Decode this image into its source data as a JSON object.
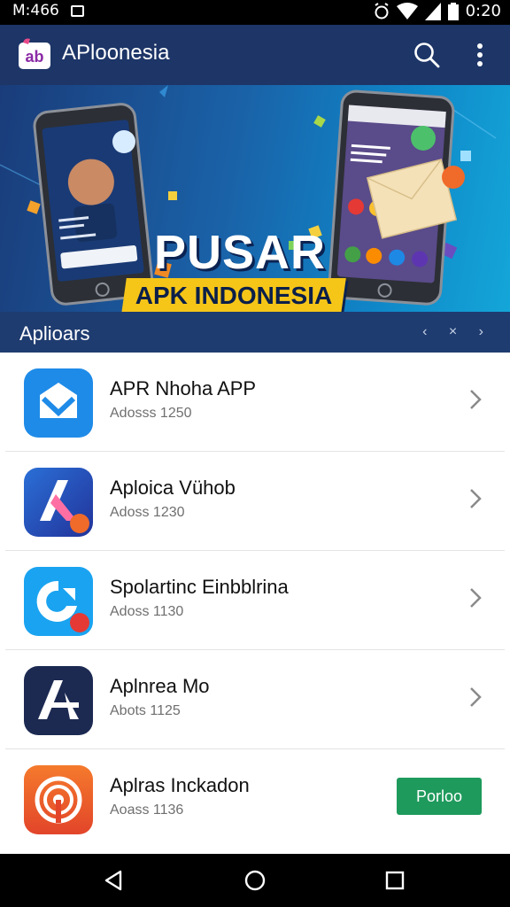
{
  "status_bar": {
    "left_text": "M:466",
    "clock": "0:20"
  },
  "app_bar": {
    "title": "APloonesia",
    "logo_text": "ab"
  },
  "banner": {
    "headline": "PUSAR",
    "ribbon": "APK INDONESIA"
  },
  "section": {
    "title": "Aplioars",
    "nav": "‹ × ›"
  },
  "apps": [
    {
      "name": "APR Nhoha APP",
      "meta": "Adosss 1250",
      "action": "chevron"
    },
    {
      "name": "Aploica Vühob",
      "meta": "Adoss 1230",
      "action": "chevron"
    },
    {
      "name": "Spolartinc Einbblrina",
      "meta": "Adoss 1130",
      "action": "chevron"
    },
    {
      "name": "Aplnrea Mo",
      "meta": "Abots 1125",
      "action": "chevron"
    },
    {
      "name": "Aplras Inckadon",
      "meta": "Aoass 1136",
      "action": "button",
      "button_label": "Porloo"
    }
  ],
  "colors": {
    "app_bar": "#1d3567",
    "section_bar": "#1f3c70",
    "open_button": "#1e9a5c"
  }
}
